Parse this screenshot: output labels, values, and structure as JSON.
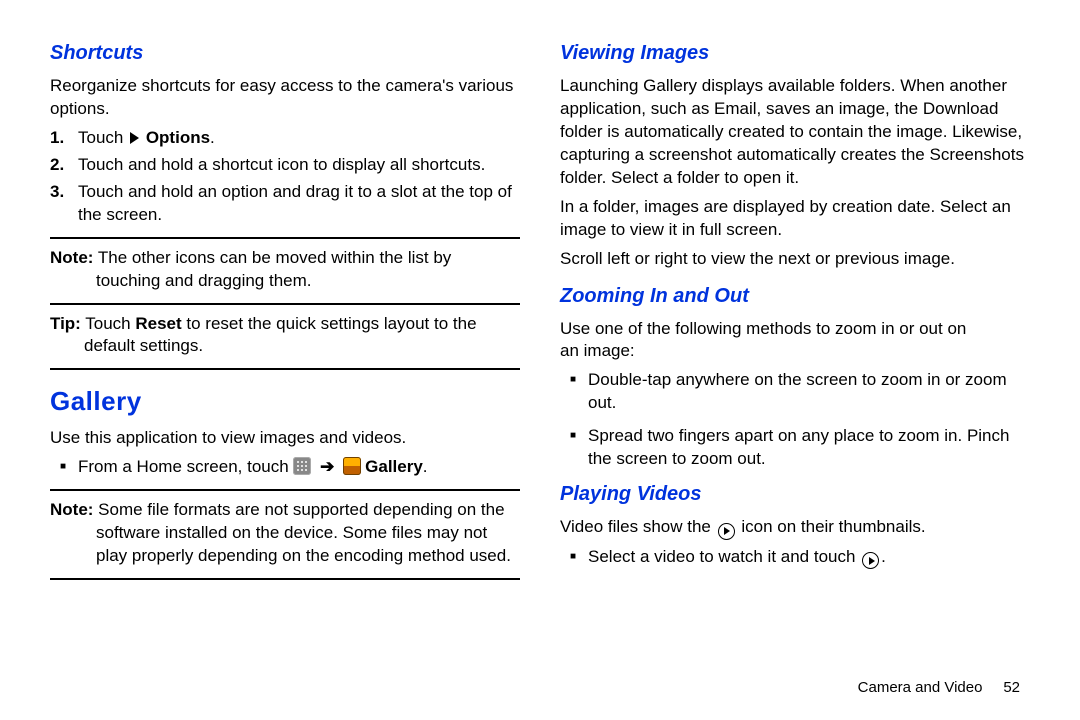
{
  "left": {
    "shortcuts_h": "Shortcuts",
    "shortcuts_intro": "Reorganize shortcuts for easy access to the camera's various options.",
    "step1_prefix": "Touch ",
    "step1_bold": "Options",
    "step1_suffix": ".",
    "step2": "Touch and hold a shortcut icon to display all shortcuts.",
    "step3": "Touch and hold an option and drag it to a slot at the top of the screen.",
    "note_label": "Note:",
    "note_body1": " The other icons can be moved within the list by",
    "note_body2": "touching and dragging them.",
    "tip_label": "Tip:",
    "tip_prefix": " Touch ",
    "tip_bold": "Reset",
    "tip_suffix": " to reset the quick settings layout to the",
    "tip_line2": "default settings.",
    "gallery_h": "Gallery",
    "gallery_intro": "Use this application to view images and videos.",
    "gallery_bullet_prefix": "From a Home screen, touch ",
    "gallery_bullet_bold": "Gallery",
    "gallery_bullet_suffix": ".",
    "note2_label": "Note:",
    "note2_l1": " Some file formats are not supported depending on the",
    "note2_l2": "software installed on the device. Some files may not",
    "note2_l3": "play properly depending on the encoding method used."
  },
  "right": {
    "view_h": "Viewing Images",
    "view_p1": "Launching Gallery displays available folders. When another application, such as Email, saves an image, the Download folder is automatically created to contain the image. Likewise, capturing a screenshot automatically creates the Screenshots folder. Select a folder to open it.",
    "view_p2": "In a folder, images are displayed by creation date. Select an image to view it in full screen.",
    "view_p3": "Scroll left or right to view the next or previous image.",
    "zoom_h": "Zooming In and Out",
    "zoom_intro1": "Use one of the following methods to zoom in or out on",
    "zoom_intro2": "an image:",
    "zoom_b1": "Double-tap anywhere on the screen to zoom in or zoom out.",
    "zoom_b2": "Spread two fingers apart on any place to zoom in. Pinch the screen to zoom out.",
    "play_h": "Playing Videos",
    "play_line_prefix": "Video files show the ",
    "play_line_suffix": " icon on their thumbnails.",
    "play_b1_prefix": "Select a video to watch it and touch ",
    "play_b1_suffix": "."
  },
  "footer": {
    "section": "Camera and Video",
    "page": "52"
  }
}
